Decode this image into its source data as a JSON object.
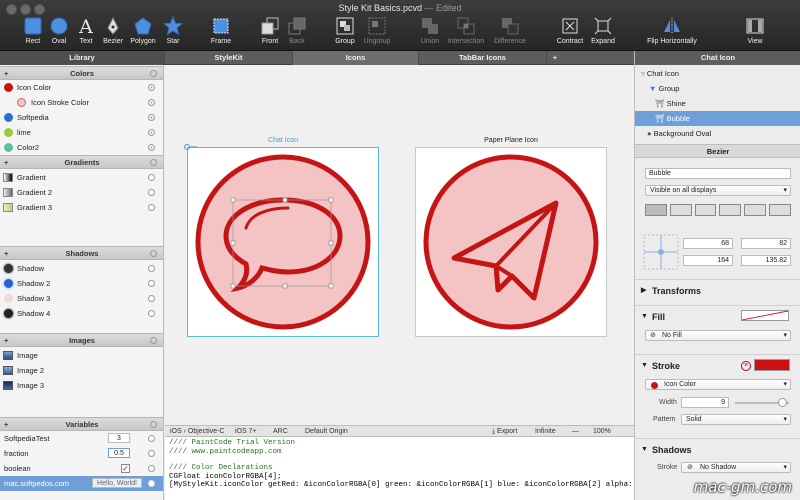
{
  "window": {
    "title": "Style Kit Basics.pcvd",
    "edited": " — Edited"
  },
  "toolbar": {
    "tools": [
      {
        "label": "Rect",
        "icon": "rect-icon"
      },
      {
        "label": "Oval",
        "icon": "oval-icon"
      },
      {
        "label": "Text",
        "icon": "text-icon"
      },
      {
        "label": "Bezier",
        "icon": "bezier-icon"
      },
      {
        "label": "Polygon",
        "icon": "polygon-icon"
      },
      {
        "label": "Star",
        "icon": "star-icon"
      },
      {
        "label": "Frame",
        "icon": "frame-icon"
      },
      {
        "label": "Front",
        "icon": "front-icon"
      },
      {
        "label": "Back",
        "icon": "back-icon"
      },
      {
        "label": "Group",
        "icon": "group-icon"
      },
      {
        "label": "Ungroup",
        "icon": "ungroup-icon"
      },
      {
        "label": "Union",
        "icon": "union-icon"
      },
      {
        "label": "Intersection",
        "icon": "intersection-icon"
      },
      {
        "label": "Difference",
        "icon": "difference-icon"
      },
      {
        "label": "Contract",
        "icon": "contract-icon"
      },
      {
        "label": "Expand",
        "icon": "expand-icon"
      },
      {
        "label": "Flip Horizontally",
        "icon": "flip-icon"
      },
      {
        "label": "View",
        "icon": "view-icon"
      }
    ]
  },
  "tabs": {
    "library": "Library",
    "t1": "StyleKit",
    "t2": "Icons",
    "t3": "TabBar Icons",
    "add": "+",
    "right": "Chat Icon"
  },
  "sidebar": {
    "colors_title": "Colors",
    "colors": [
      {
        "name": "Icon Color",
        "color": "#cc1111"
      },
      {
        "name": "Icon Stroke Color",
        "color": "#f4c4c4"
      },
      {
        "name": "Softpedia",
        "color": "#2a6fd1"
      },
      {
        "name": "lime",
        "color": "#9ccc3c"
      },
      {
        "name": "Color2",
        "color": "#5cc0a0"
      }
    ],
    "gradients_title": "Gradients",
    "gradients": [
      "Gradient",
      "Gradient 2",
      "Gradient 3"
    ],
    "shadows_title": "Shadows",
    "shadows": [
      "Shadow",
      "Shadow 2",
      "Shadow 3",
      "Shadow 4"
    ],
    "images_title": "Images",
    "images": [
      "Image",
      "Image 2",
      "Image 3"
    ],
    "variables_title": "Variables",
    "variables": [
      {
        "name": "SoftpediaTest",
        "value": "3"
      },
      {
        "name": "fraction",
        "value": "0.5"
      },
      {
        "name": "boolean",
        "value": ""
      },
      {
        "name": "mac.softpedos.com",
        "value": "Hello, World!"
      }
    ]
  },
  "canvas": {
    "art1_title": "Chat Icon",
    "art2_title": "Paper Plane Icon"
  },
  "codebar": {
    "lang": "iOS › Objective-C",
    "ios": "iOS 7+",
    "arc": "ARC",
    "origin": "Default Origin",
    "export": "Export",
    "infinite": "Infinite",
    "minus": "—",
    "zoom": "100%"
  },
  "code": {
    "l1": "//// PaintCode Trial Version",
    "l2": "//// www.paintcodeapp.com",
    "l3": "//// Color Declarations",
    "l4": "CGFloat iconColorRGBA[4];",
    "l5": "[MyStyleKit.iconColor getRed: &iconColorRGBA[0] green: &iconColorRGBA[1] blue: &iconColorRGBA[2] alpha: &icon"
  },
  "tree": {
    "root": "Chat Icon",
    "group": "Group",
    "shine": "Shine",
    "bubble": "Bubble",
    "bg": "Background Oval"
  },
  "bezier": {
    "title": "Bezier",
    "name": "Bubble",
    "visibility": "Visible on all displays",
    "x_label": "X",
    "x": "68",
    "y_label": "Y",
    "y": "82",
    "w_label": "W",
    "w": "164",
    "h_label": "H",
    "h": "135.82",
    "transforms": "Transforms",
    "fill": "Fill",
    "fill_value": "No Fill",
    "stroke": "Stroke",
    "stroke_color": "Icon Color",
    "width_label": "Width",
    "width_value": "9",
    "pattern_label": "Pattern",
    "pattern_value": "Solid",
    "shadows": "Shadows",
    "stroke_shadow_label": "Stroke",
    "stroke_shadow": "No Shadow"
  },
  "watermark": "mac-gm.com",
  "colors": {
    "accent": "#cc1111",
    "selection": "#6f9fd8",
    "icon_fill": "#f4c4c4",
    "selection_frame": "#5bb8e0"
  }
}
